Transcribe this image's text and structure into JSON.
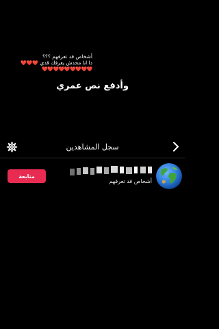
{
  "caption": {
    "line1": "أشخاص قد تعرفهم ؟؟؟",
    "line2": "دا انا محدش يعرفك قدي",
    "line2_hearts": "❤️❤️❤️",
    "hearts_row": "❤️❤️❤️❤️❤️❤️❤️❤️❤️"
  },
  "overlay_text": "وأدفع نص عمري",
  "viewers_sheet": {
    "title": "سجل المشاهدين",
    "settings_icon": "gear-icon",
    "back_icon": "chevron-right-icon"
  },
  "viewer": {
    "name_hidden": "pixelated",
    "subtitle": "أشخاص قد تعرفهم",
    "follow_label": "متابعة",
    "avatar_icon": "globe-icon"
  },
  "colors": {
    "background": "#000000",
    "follow_button": "#e82c51",
    "divider": "#2b2b2b"
  }
}
